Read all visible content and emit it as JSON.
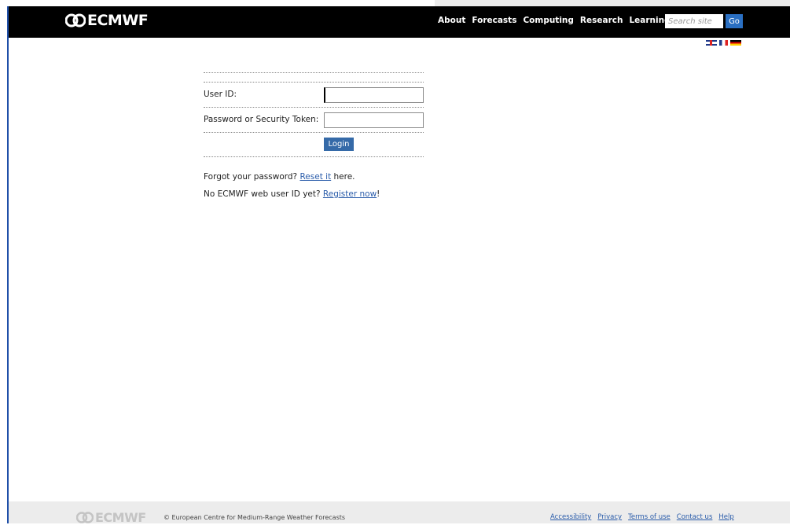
{
  "header": {
    "logo_text": "ECMWF",
    "nav": [
      "About",
      "Forecasts",
      "Computing",
      "Research",
      "Learning"
    ],
    "search": {
      "placeholder": "Search site",
      "go_label": "Go"
    },
    "languages": [
      "uk-flag-icon",
      "fr-flag-icon",
      "de-flag-icon"
    ]
  },
  "login": {
    "user_id_label": "User ID:",
    "password_label": "Password or Security Token:",
    "user_id_value": "",
    "password_value": "",
    "login_label": "Login"
  },
  "links": {
    "forgot_prefix": "Forgot your password? ",
    "reset_link": "Reset it",
    "forgot_suffix": " here.",
    "register_prefix": "No ECMWF web user ID yet? ",
    "register_link": "Register now",
    "register_suffix": "!"
  },
  "footer": {
    "logo_text": "ECMWF",
    "copyright": "© European Centre for Medium-Range Weather Forecasts",
    "links": [
      "Accessibility",
      "Privacy",
      "Terms of use",
      "Contact us",
      "Help"
    ]
  },
  "colors": {
    "header_bg": "#000000",
    "accent": "#356aa8",
    "link": "#2a5caa",
    "footer_bg": "#ececec"
  }
}
